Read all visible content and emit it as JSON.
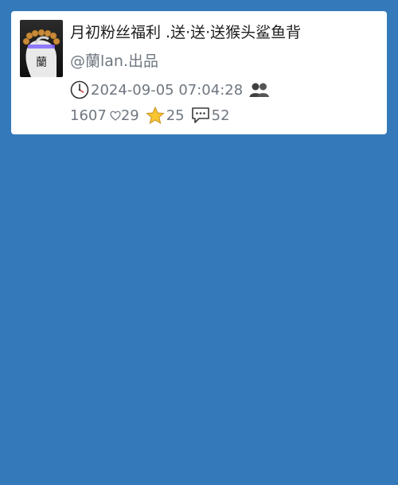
{
  "post": {
    "title": "月初粉丝福利 .送·送·送猴头鲨鱼背",
    "author": "@蘭lan.出品",
    "timestamp": "2024-09-05 07:04:28",
    "views": "1607",
    "likes": "29",
    "favorites": "25",
    "comments": "52",
    "thumbnail_icon": "bracelet-photo",
    "icons": {
      "clock": "clock-icon",
      "people": "people-icon",
      "heart": "heart-icon",
      "star": "star-icon",
      "comment": "comment-icon"
    }
  },
  "colors": {
    "background": "#347abb",
    "card": "#ffffff",
    "title_text": "#1e1e1e",
    "meta_text": "#6f7780",
    "star_fill": "#f7c531"
  }
}
